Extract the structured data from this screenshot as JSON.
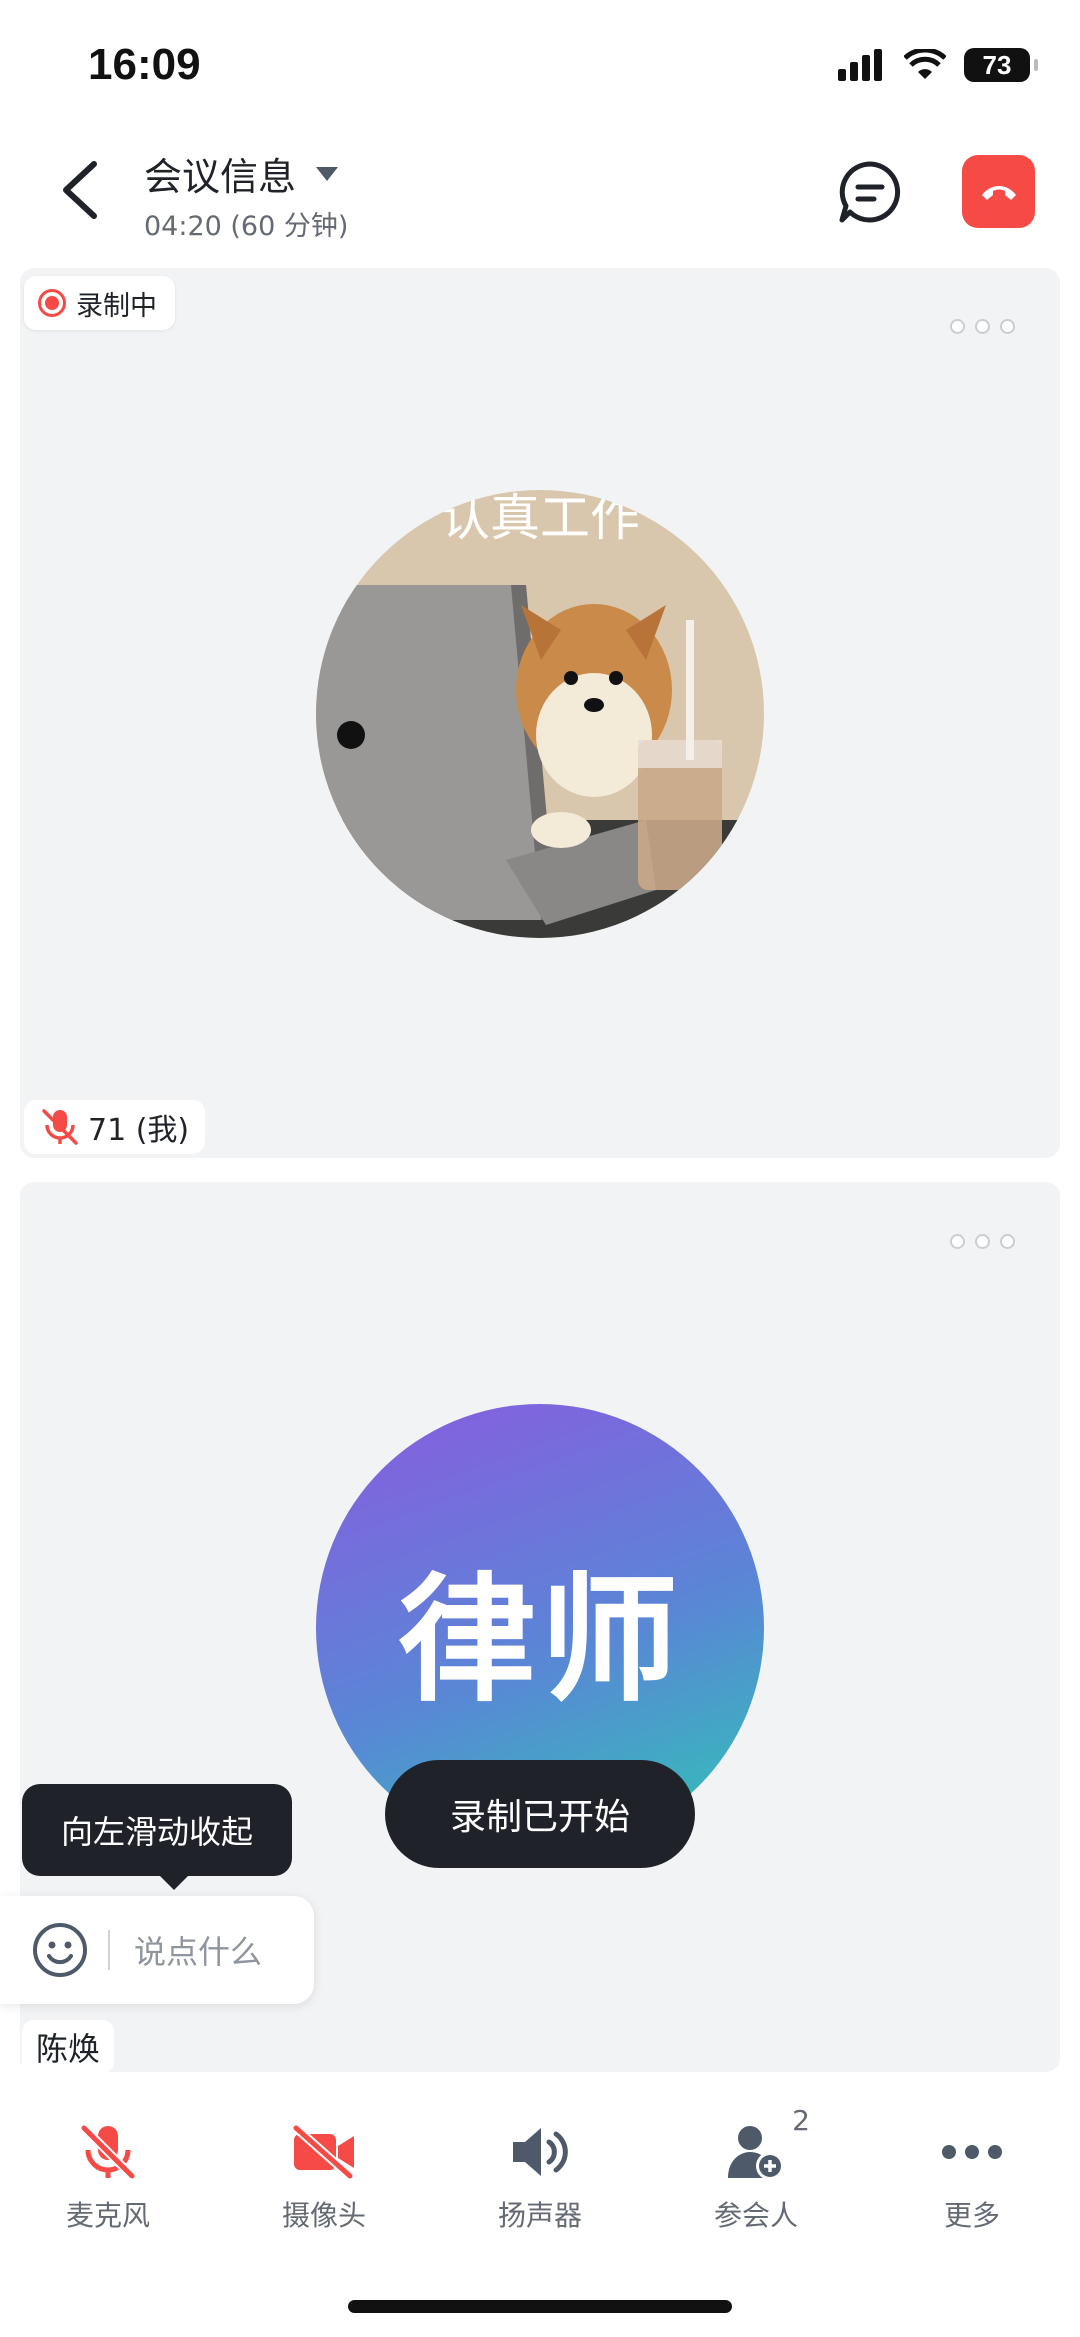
{
  "status_bar": {
    "time": "16:09",
    "battery": "73"
  },
  "header": {
    "title": "会议信息",
    "subtitle": "04:20 (60 分钟)"
  },
  "tile1": {
    "recording_label": "录制中",
    "avatar_caption": "认真工作",
    "name": "71 (我)"
  },
  "tile2": {
    "avatar_text": "律师",
    "name": "陈焕"
  },
  "toast": "录制已开始",
  "tooltip": "向左滑动收起",
  "chat_input": {
    "placeholder": "说点什么"
  },
  "toolbar": {
    "items": [
      {
        "label": "麦克风"
      },
      {
        "label": "摄像头"
      },
      {
        "label": "扬声器"
      },
      {
        "label": "参会人",
        "count": "2"
      },
      {
        "label": "更多"
      }
    ]
  },
  "colors": {
    "accent_red": "#f54a45",
    "toast_bg": "#1f2329",
    "tile_bg": "#f2f3f5"
  }
}
